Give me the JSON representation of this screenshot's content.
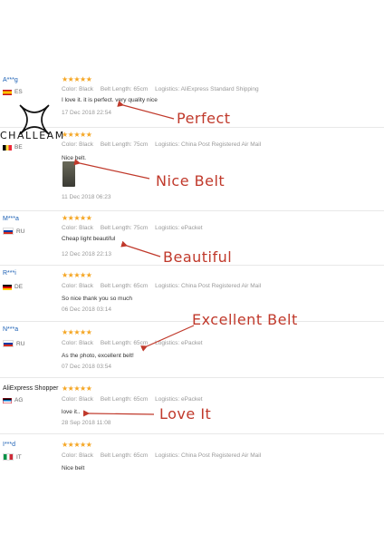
{
  "brand": "CHALLEAM",
  "meta_labels": {
    "color": "Color:",
    "belt_length": "Belt Length:",
    "logistics": "Logistics:"
  },
  "reviews": [
    {
      "user": "A***g",
      "country": "ES",
      "stars": "★★★★★",
      "color": "Black",
      "belt_length": "65cm",
      "logistics": "AliExpress Standard Shipping",
      "text": "I love it. it is perfect. very quality nice",
      "date": "17 Dec 2018 22:54",
      "callout": "Perfect"
    },
    {
      "user": "",
      "country": "BE",
      "stars": "★★★★★",
      "color": "Black",
      "belt_length": "75cm",
      "logistics": "China Post Registered Air Mail",
      "text": "Nice belt.",
      "date": "11 Dec 2018 06:23",
      "callout": "Nice Belt"
    },
    {
      "user": "M***a",
      "country": "RU",
      "stars": "★★★★★",
      "color": "Black",
      "belt_length": "75cm",
      "logistics": "ePacket",
      "text": "Cheap light beautiful",
      "date": "12 Dec 2018 22:13",
      "callout": "Beautiful"
    },
    {
      "user": "R***i",
      "country": "DE",
      "stars": "★★★★★",
      "color": "Black",
      "belt_length": "65cm",
      "logistics": "China Post Registered Air Mail",
      "text": "So nice thank you so much",
      "date": "06 Dec 2018 03:14",
      "callout": ""
    },
    {
      "user": "N***a",
      "country": "RU",
      "stars": "★★★★★",
      "color": "Black",
      "belt_length": "65cm",
      "logistics": "ePacket",
      "text": "As the photo, excellent belt!",
      "date": "07 Dec 2018 03:54",
      "callout": "Excellent Belt"
    },
    {
      "user": "AliExpress Shopper",
      "country": "AG",
      "stars": "★★★★★",
      "color": "Black",
      "belt_length": "65cm",
      "logistics": "ePacket",
      "text": "love it..",
      "date": "28 Sep 2018 11:08",
      "callout": "Love It"
    },
    {
      "user": "I***d",
      "country": "IT",
      "stars": "★★★★★",
      "color": "Black",
      "belt_length": "65cm",
      "logistics": "China Post Registered Air Mail",
      "text": "Nice belt",
      "date": "",
      "callout": ""
    }
  ],
  "colors": {
    "accent": "#c0392b",
    "star": "#f5a623",
    "username": "#1a5fb4"
  }
}
